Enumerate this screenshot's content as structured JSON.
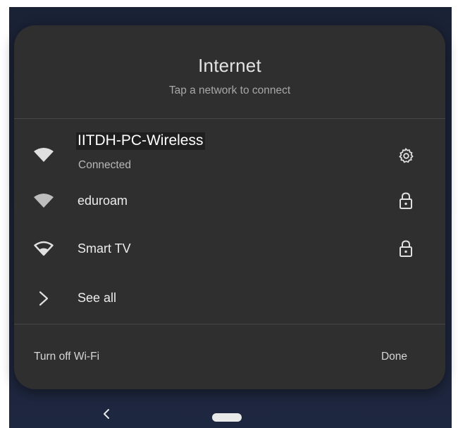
{
  "panel": {
    "title": "Internet",
    "subtitle": "Tap a network to connect"
  },
  "networks": [
    {
      "ssid": "IITDH-PC-Wireless",
      "status": "Connected",
      "signal_icon": "wifi-signal-full-icon",
      "trailing_icon": "settings-gear-icon"
    },
    {
      "ssid": "eduroam",
      "status": "",
      "signal_icon": "wifi-signal-full-icon",
      "trailing_icon": "lock-icon"
    },
    {
      "ssid": "Smart TV",
      "status": "",
      "signal_icon": "wifi-signal-partial-icon",
      "trailing_icon": "lock-icon"
    }
  ],
  "see_all": {
    "label": "See all",
    "icon": "chevron-right-icon"
  },
  "footer": {
    "turn_off_wifi_label": "Turn off Wi-Fi",
    "done_label": "Done"
  },
  "navigation_bar": {
    "back_icon": "back-chevron-icon",
    "home_icon": "home-pill-icon"
  },
  "colors": {
    "panel_background": "#2f2f2f",
    "screen_background": "#1a2236",
    "primary_text": "#ececec",
    "secondary_text": "#a8a8a8",
    "icon": "#e0e0e0"
  }
}
